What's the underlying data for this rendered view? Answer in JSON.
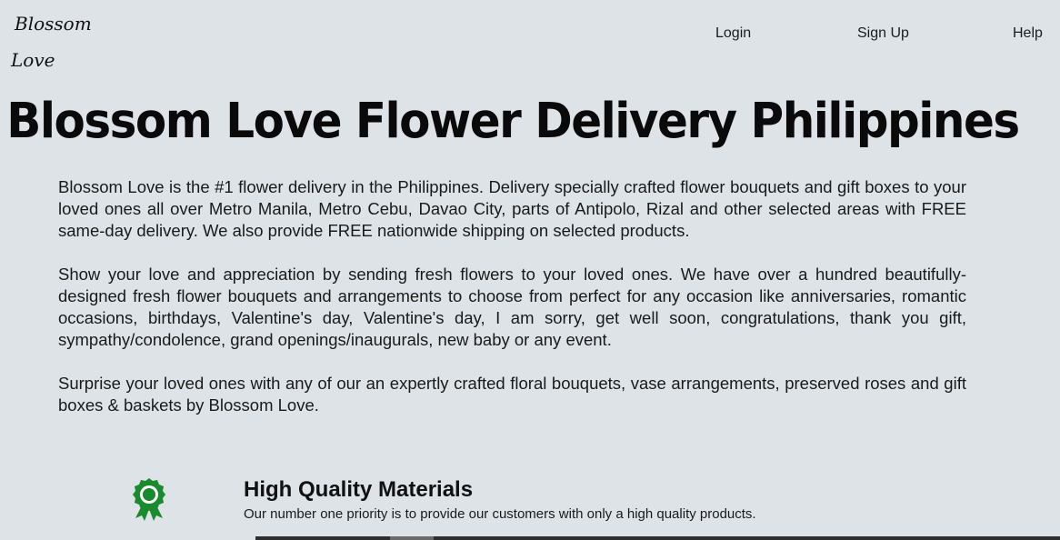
{
  "header": {
    "logo_line1": "Blossom",
    "logo_line2": "Love",
    "nav": {
      "login": "Login",
      "signup": "Sign Up",
      "help": "Help"
    }
  },
  "main": {
    "title": "Blossom Love Flower Delivery Philippines",
    "paragraphs": [
      "Blossom Love is the #1 flower delivery in the Philippines. Delivery specially crafted flower bouquets and gift boxes to your loved ones all over Metro Manila, Metro Cebu, Davao City, parts of Antipolo, Rizal and other selected areas with FREE same-day delivery. We also provide FREE nationwide shipping on selected products.",
      "Show your love and appreciation by sending fresh flowers to your loved ones. We have over a hundred beautifully-designed fresh flower bouquets and arrangements to choose from perfect for any occasion like anniversaries, romantic occasions, birthdays, Valentine's day, Valentine's day, I am sorry, get well soon, congratulations, thank you gift, sympathy/condolence, grand openings/inaugurals, new baby or any event.",
      "Surprise your loved ones with any of our an expertly crafted floral bouquets, vase arrangements, preserved roses and gift boxes & baskets by Blossom Love."
    ]
  },
  "feature": {
    "icon": "award-ribbon-icon",
    "icon_color": "#1a8a2e",
    "title": "High Quality Materials",
    "description": "Our number one priority is to provide our customers with only a high quality products."
  }
}
